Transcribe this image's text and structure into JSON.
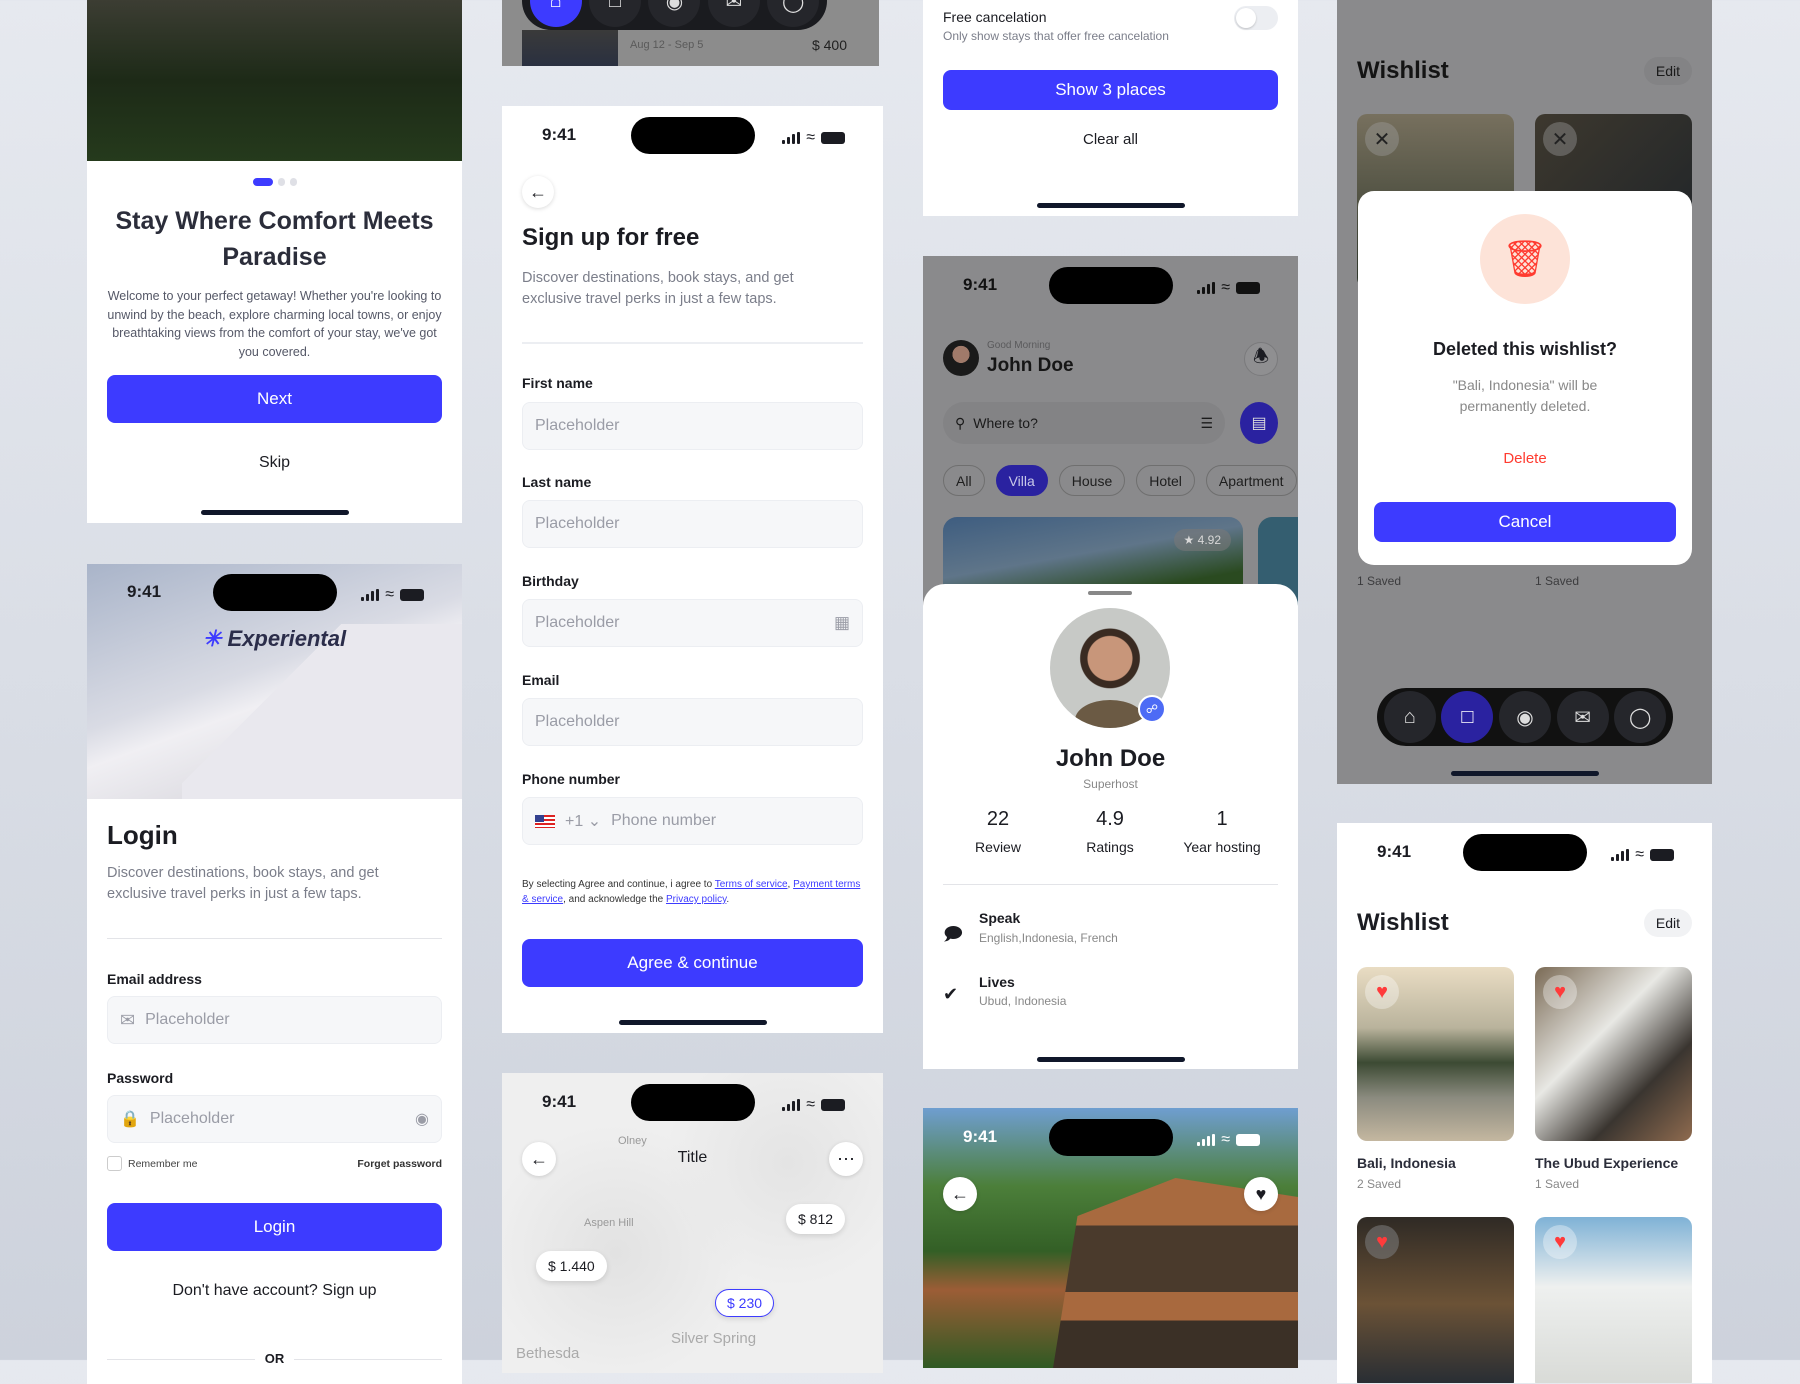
{
  "status": {
    "time": "9:41"
  },
  "onboarding": {
    "title": "Stay Where Comfort Meets Paradise",
    "body": "Welcome to your perfect getaway! Whether you're looking to unwind by the beach, explore charming local towns, or enjoy breathtaking views from the comfort of your stay, we've got you covered.",
    "next": "Next",
    "skip": "Skip",
    "page_index": 1,
    "page_count": 3
  },
  "login": {
    "brand": "Experiental",
    "title": "Login",
    "desc": "Discover destinations, book stays, and get exclusive travel perks in just a few taps.",
    "email_label": "Email address",
    "email_placeholder": "Placeholder",
    "password_label": "Password",
    "password_placeholder": "Placeholder",
    "remember": "Remember me",
    "forgot": "Forget password",
    "login_button": "Login",
    "signup_prompt": "Don't have account? Sign up",
    "or": "OR"
  },
  "trip_peek": {
    "dates": "Aug 12 - Sep 5",
    "price": "$ 400"
  },
  "signup": {
    "title": "Sign up for free",
    "desc": "Discover destinations, book stays, and get exclusive travel perks in just a few taps.",
    "fields": [
      {
        "label": "First name",
        "placeholder": "Placeholder"
      },
      {
        "label": "Last name",
        "placeholder": "Placeholder"
      },
      {
        "label": "Birthday",
        "placeholder": "Placeholder"
      },
      {
        "label": "Email",
        "placeholder": "Placeholder"
      }
    ],
    "phone_label": "Phone number",
    "country_code": "+1",
    "phone_placeholder": "Phone number",
    "terms_prefix": "By selecting Agree and continue, i agree to ",
    "terms_link": "Terms of service",
    "terms_sep": ", ",
    "payment_link": "Payment terms & service",
    "terms_mid": ", and acknowledge the ",
    "privacy_link": "Privacy policy",
    "terms_end": ".",
    "agree_button": "Agree & continue"
  },
  "map": {
    "title": "Title",
    "places": [
      "Olney",
      "Aspen Hill",
      "Silver Spring",
      "Bethesda"
    ],
    "pins": [
      "$ 812",
      "$ 1.440",
      "$ 230"
    ],
    "selected_pin": "$ 230"
  },
  "filter": {
    "free_cancel_title": "Free cancelation",
    "free_cancel_sub": "Only show stays that offer free cancelation",
    "free_cancel_on": false,
    "show_button": "Show 3 places",
    "clear_all": "Clear all"
  },
  "home": {
    "greeting": "Good Morning",
    "name": "John Doe",
    "search_placeholder": "Where to?",
    "chips": [
      "All",
      "Villa",
      "House",
      "Hotel",
      "Apartment"
    ],
    "active_chip": "Villa",
    "rating": "4.92"
  },
  "profile": {
    "name": "John Doe",
    "role": "Superhost",
    "stats": [
      {
        "value": "22",
        "label": "Review"
      },
      {
        "value": "4.9",
        "label": "Ratings"
      },
      {
        "value": "1",
        "label": "Year hosting"
      }
    ],
    "speak_title": "Speak",
    "speak_value": "English,Indonesia, French",
    "lives_title": "Lives",
    "lives_value": "Ubud, Indonesia"
  },
  "wishlist_modal": {
    "title": "Wishlist",
    "edit": "Edit",
    "dialog_title": "Deleted this wishlist?",
    "dialog_body": "\"Bali, Indonesia\" will be permanently deleted.",
    "delete": "Delete",
    "cancel": "Cancel",
    "saved_left": "1 Saved",
    "saved_right": "1 Saved"
  },
  "wishlist": {
    "title": "Wishlist",
    "edit": "Edit",
    "items": [
      {
        "name": "Bali, Indonesia",
        "saved": "2 Saved"
      },
      {
        "name": "The Ubud Experience",
        "saved": "1 Saved"
      }
    ]
  },
  "colors": {
    "primary": "#3d3bff",
    "danger": "#ff3b30",
    "text": "#1b1c22"
  },
  "icons": [
    "arrow-left-icon",
    "calendar-icon",
    "mail-icon",
    "lock-icon",
    "eye-icon",
    "bell-icon",
    "search-icon",
    "filter-icon",
    "map-icon",
    "heart-icon",
    "trash-icon",
    "home-icon",
    "bookmark-icon",
    "location-icon",
    "chat-icon",
    "user-icon",
    "more-icon",
    "star-icon",
    "verified-icon",
    "check-shield-icon"
  ]
}
